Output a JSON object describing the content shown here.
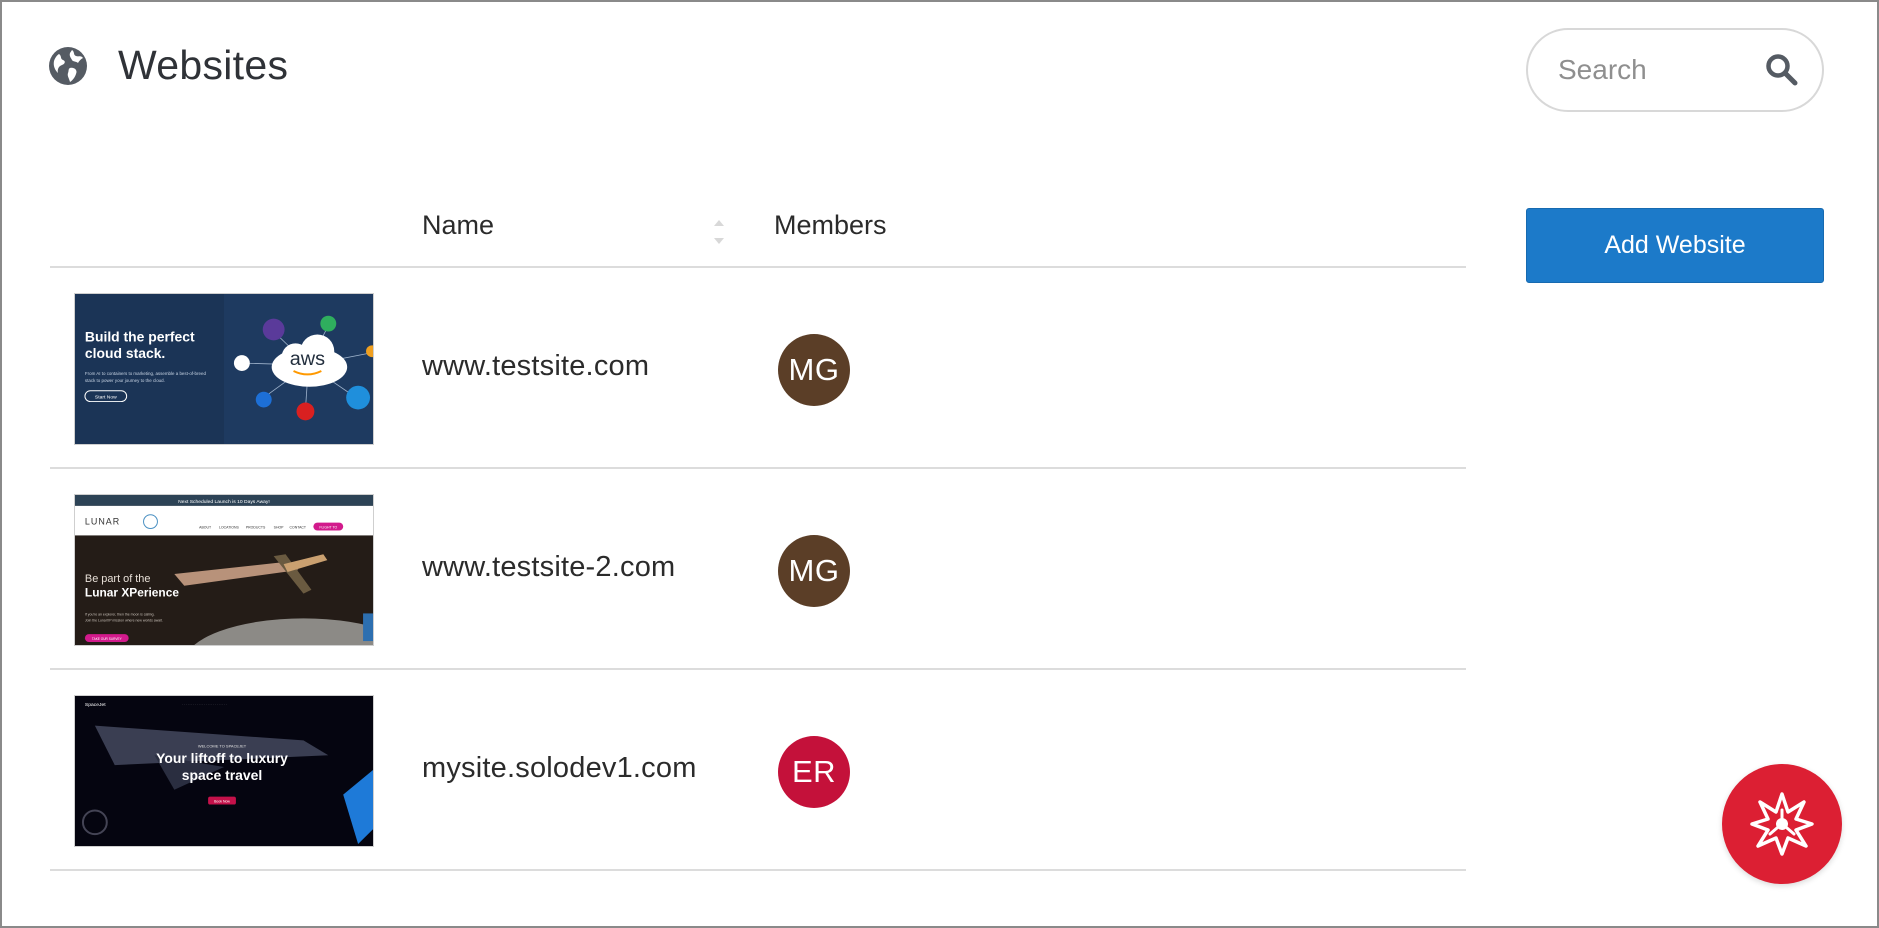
{
  "header": {
    "title": "Websites",
    "icon": "globe-icon"
  },
  "search": {
    "placeholder": "Search",
    "value": ""
  },
  "table": {
    "columns": [
      "",
      "Name",
      "Members"
    ],
    "sort_column": "Name",
    "rows": [
      {
        "name": "www.testsite.com",
        "member_initials": "MG",
        "avatar_color": "#5b3e27",
        "thumbnail": {
          "headline": "Build the perfect cloud stack.",
          "line1": "From AI to containers to marketing, assemble a best-of-breed",
          "line2": "stack to power your journey to the cloud.",
          "cta": "Start Now",
          "logo": "aws",
          "bg_color": "#1b3456"
        }
      },
      {
        "name": "www.testsite-2.com",
        "member_initials": "MG",
        "avatar_color": "#5b3e27",
        "thumbnail": {
          "banner": "Next Scheduled Launch is 10 Days Away!",
          "logo": "LUNAR",
          "nav": [
            "ABOUT",
            "LOCATIONS",
            "PRODUCTS",
            "SHOP",
            "CONTACT"
          ],
          "nav_cta": "FLIGHT TO",
          "headline_1": "Be part of the",
          "headline_2": "Lunar XPerience",
          "body_1": "If you're an explorer, then the moon is calling.",
          "body_2": "Join the LunarXP mission where new worlds await.",
          "cta": "TAKE OUR SURVEY",
          "accent": "#d21a8c"
        }
      },
      {
        "name": "mysite.solodev1.com",
        "member_initials": "ER",
        "avatar_color": "#c4113a",
        "thumbnail": {
          "logo": "SpaceJet",
          "eyebrow": "WELCOME TO SPACEJET",
          "headline_1": "Your liftoff to luxury",
          "headline_2": "space travel",
          "cta": "Book Now",
          "accent": "#c4114a"
        }
      }
    ]
  },
  "actions": {
    "add_label": "Add Website"
  },
  "fab": {
    "icon": "solodev-star-icon",
    "color": "#dc1f33"
  },
  "colors": {
    "primary": "#1c7ac9",
    "divider": "#dcdcdc"
  }
}
